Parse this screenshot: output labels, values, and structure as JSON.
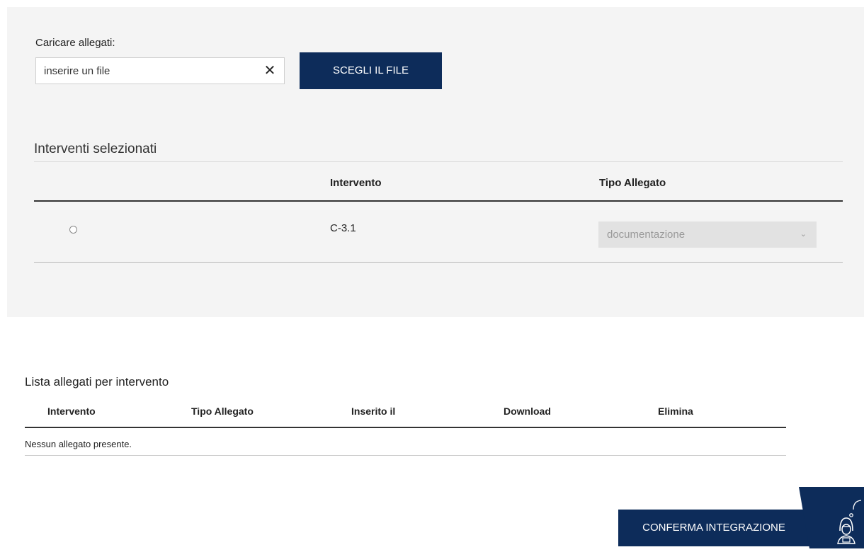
{
  "upload": {
    "label": "Caricare allegati:",
    "placeholder": "inserire un file",
    "clear_icon": "✕",
    "choose_button": "SCEGLI IL FILE"
  },
  "selected": {
    "title": "Interventi selezionati",
    "headers": {
      "intervento": "Intervento",
      "tipo": "Tipo Allegato"
    },
    "rows": [
      {
        "intervento": "C-3.1",
        "tipo": "documentazione"
      }
    ],
    "chevron_icon": "⌄"
  },
  "list": {
    "title": "Lista allegati per intervento",
    "headers": [
      "Intervento",
      "Tipo Allegato",
      "Inserito il",
      "Download",
      "Elimina"
    ],
    "empty_message": "Nessun allegato presente."
  },
  "actions": {
    "confirm_button": "CONFERMA INTEGRAZIONE"
  },
  "icons": {
    "clear": "close-icon",
    "chevron": "chevron-down-icon",
    "assistant": "assistant-avatar-icon"
  },
  "colors": {
    "brand_navy": "#0d2c5a",
    "panel_bg": "#f4f4f4"
  }
}
